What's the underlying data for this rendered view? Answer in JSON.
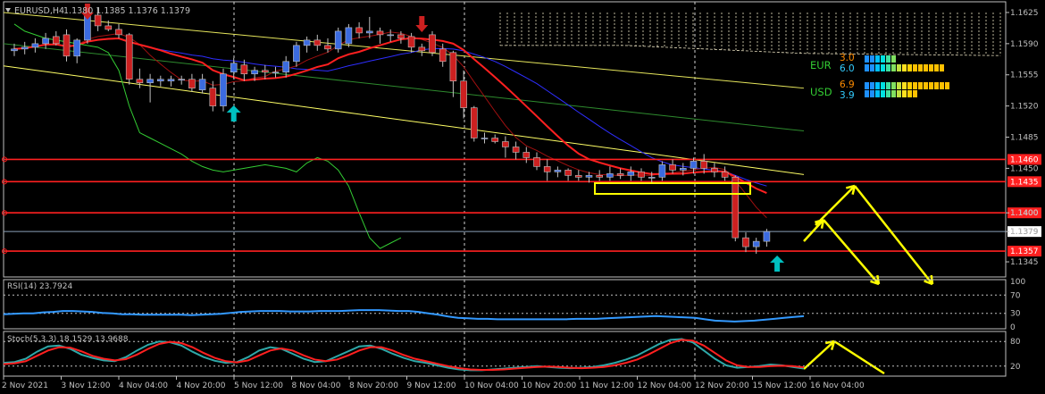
{
  "window": {
    "symbol_label": "EURUSD,H4",
    "ohlc_label": "1.1380 1.1385 1.1376 1.1379"
  },
  "panels": {
    "rsi_label": "RSI(14) 23.7924",
    "stoch_label": "Stoch(5,3,3) 18.1529 13.9688"
  },
  "strength_meter": {
    "rows": [
      {
        "currency": "EUR",
        "value_top": "3.0",
        "value_bottom": "6.0"
      },
      {
        "currency": "USD",
        "value_top": "6.9",
        "value_bottom": "3.9"
      }
    ]
  },
  "colors": {
    "background": "#000000",
    "bull": "#3b6be0",
    "bear": "#cc2020",
    "sr_line": "#ff2020",
    "ma_fast": "#ff2020",
    "ma_slow": "#2e2eff",
    "signal_arrows": "#00c0c0",
    "projection": "#ffff00",
    "rsi": "#3399ff",
    "stoch_main": "#2ea8a8",
    "stoch_signal": "#ff2020",
    "box": "#ffff00"
  },
  "chart_data": [
    {
      "type": "candlestick",
      "name": "EURUSD,H4",
      "price_axis_ticks": [
        "1.1625",
        "1.1590",
        "1.1555",
        "1.1520",
        "1.1485",
        "1.1450",
        "1.1400",
        "1.1379",
        "1.1345"
      ],
      "sr_levels": [
        {
          "price": 1.146,
          "label": "1.1460"
        },
        {
          "price": 1.1435,
          "label": "1.1435"
        },
        {
          "price": 1.14,
          "label": "1.1400"
        },
        {
          "price": 1.1357,
          "label": "1.1357"
        }
      ],
      "current_price": {
        "price": 1.1379,
        "label": "1.1379"
      },
      "time_axis_labels": [
        "2 Nov 2021",
        "3 Nov 12:00",
        "4 Nov 04:00",
        "4 Nov 20:00",
        "5 Nov 12:00",
        "8 Nov 04:00",
        "8 Nov 20:00",
        "9 Nov 12:00",
        "10 Nov 04:00",
        "10 Nov 20:00",
        "11 Nov 12:00",
        "12 Nov 04:00",
        "12 Nov 20:00",
        "15 Nov 12:00",
        "16 Nov 04:00"
      ],
      "ylim": [
        1.133,
        1.1635
      ],
      "candles": [
        [
          1.1582,
          1.159,
          1.1576,
          1.1584
        ],
        [
          1.1584,
          1.1592,
          1.1578,
          1.1586
        ],
        [
          1.1586,
          1.1596,
          1.158,
          1.159
        ],
        [
          1.159,
          1.1602,
          1.1584,
          1.1596
        ],
        [
          1.1598,
          1.1604,
          1.1588,
          1.159
        ],
        [
          1.16,
          1.1606,
          1.157,
          1.1576
        ],
        [
          1.1576,
          1.1596,
          1.1568,
          1.1594
        ],
        [
          1.1594,
          1.1628,
          1.159,
          1.1622
        ],
        [
          1.1622,
          1.163,
          1.1604,
          1.161
        ],
        [
          1.161,
          1.1616,
          1.1604,
          1.1606
        ],
        [
          1.1606,
          1.1612,
          1.1596,
          1.16
        ],
        [
          1.16,
          1.1602,
          1.1544,
          1.155
        ],
        [
          1.155,
          1.1562,
          1.154,
          1.1546
        ],
        [
          1.1546,
          1.1556,
          1.1524,
          1.155
        ],
        [
          1.1548,
          1.1554,
          1.1542,
          1.155
        ],
        [
          1.1548,
          1.1554,
          1.1542,
          1.155
        ],
        [
          1.155,
          1.1554,
          1.1544,
          1.155
        ],
        [
          1.155,
          1.1556,
          1.1536,
          1.154
        ],
        [
          1.1538,
          1.1556,
          1.1534,
          1.155
        ],
        [
          1.154,
          1.1548,
          1.1514,
          1.152
        ],
        [
          1.152,
          1.1562,
          1.1514,
          1.1556
        ],
        [
          1.1558,
          1.1574,
          1.155,
          1.1568
        ],
        [
          1.1566,
          1.1572,
          1.1548,
          1.1556
        ],
        [
          1.1556,
          1.1564,
          1.1548,
          1.156
        ],
        [
          1.156,
          1.1566,
          1.155,
          1.1558
        ],
        [
          1.1558,
          1.1564,
          1.1552,
          1.1558
        ],
        [
          1.1558,
          1.1576,
          1.1552,
          1.157
        ],
        [
          1.157,
          1.1592,
          1.1564,
          1.1588
        ],
        [
          1.1588,
          1.1598,
          1.158,
          1.1594
        ],
        [
          1.1594,
          1.16,
          1.1582,
          1.1588
        ],
        [
          1.1588,
          1.1596,
          1.158,
          1.1584
        ],
        [
          1.1584,
          1.1608,
          1.158,
          1.1604
        ],
        [
          1.159,
          1.1612,
          1.1586,
          1.1608
        ],
        [
          1.1608,
          1.1614,
          1.1596,
          1.1602
        ],
        [
          1.1602,
          1.162,
          1.1596,
          1.1604
        ],
        [
          1.1604,
          1.1608,
          1.159,
          1.16
        ],
        [
          1.16,
          1.1606,
          1.1592,
          1.16
        ],
        [
          1.16,
          1.1604,
          1.159,
          1.1596
        ],
        [
          1.1598,
          1.1602,
          1.158,
          1.1586
        ],
        [
          1.1586,
          1.159,
          1.1576,
          1.1582
        ],
        [
          1.16,
          1.1604,
          1.1576,
          1.158
        ],
        [
          1.1584,
          1.159,
          1.1564,
          1.157
        ],
        [
          1.158,
          1.1582,
          1.153,
          1.1548
        ],
        [
          1.1548,
          1.156,
          1.1506,
          1.1518
        ],
        [
          1.1518,
          1.152,
          1.148,
          1.1484
        ],
        [
          1.1484,
          1.149,
          1.1478,
          1.1484
        ],
        [
          1.1484,
          1.1488,
          1.1478,
          1.148
        ],
        [
          1.148,
          1.1486,
          1.1462,
          1.1474
        ],
        [
          1.1474,
          1.148,
          1.146,
          1.1468
        ],
        [
          1.1468,
          1.1474,
          1.1456,
          1.1462
        ],
        [
          1.1462,
          1.1468,
          1.1448,
          1.1452
        ],
        [
          1.1452,
          1.146,
          1.1436,
          1.1446
        ],
        [
          1.1446,
          1.1452,
          1.144,
          1.1448
        ],
        [
          1.1448,
          1.145,
          1.1436,
          1.1442
        ],
        [
          1.1442,
          1.1448,
          1.1436,
          1.144
        ],
        [
          1.144,
          1.1446,
          1.1434,
          1.1442
        ],
        [
          1.1442,
          1.1448,
          1.1436,
          1.144
        ],
        [
          1.144,
          1.1452,
          1.1436,
          1.1444
        ],
        [
          1.1444,
          1.145,
          1.1438,
          1.1442
        ],
        [
          1.1442,
          1.1452,
          1.1436,
          1.1446
        ],
        [
          1.1446,
          1.145,
          1.1436,
          1.144
        ],
        [
          1.144,
          1.1446,
          1.1434,
          1.144
        ],
        [
          1.144,
          1.1458,
          1.1436,
          1.1454
        ],
        [
          1.1454,
          1.146,
          1.1444,
          1.1448
        ],
        [
          1.1448,
          1.1456,
          1.1442,
          1.145
        ],
        [
          1.145,
          1.1462,
          1.1444,
          1.1458
        ],
        [
          1.1458,
          1.1466,
          1.1444,
          1.145
        ],
        [
          1.145,
          1.1456,
          1.144,
          1.1446
        ],
        [
          1.1446,
          1.1452,
          1.1436,
          1.144
        ],
        [
          1.144,
          1.1442,
          1.1368,
          1.1372
        ],
        [
          1.1372,
          1.1378,
          1.1356,
          1.1362
        ],
        [
          1.1362,
          1.1372,
          1.1354,
          1.1368
        ],
        [
          1.1368,
          1.1382,
          1.1362,
          1.1379
        ]
      ]
    },
    {
      "type": "line",
      "name": "RSI(14)",
      "ylim": [
        0,
        100
      ],
      "y_ticks": [
        "100",
        "70",
        "30",
        "0"
      ],
      "levels": [
        70,
        30
      ],
      "values": [
        28,
        29,
        30,
        30,
        32,
        33,
        35,
        35,
        34,
        33,
        31,
        30,
        28,
        28,
        27,
        27,
        27,
        27,
        27,
        26,
        27,
        28,
        29,
        31,
        33,
        34,
        35,
        35,
        35,
        34,
        34,
        34,
        35,
        35,
        35,
        36,
        37,
        37,
        37,
        36,
        35,
        35,
        33,
        30,
        27,
        23,
        20,
        19,
        18,
        18,
        17,
        17,
        17,
        17,
        17,
        17,
        17,
        17,
        18,
        18,
        18,
        19,
        20,
        21,
        22,
        23,
        24,
        23,
        22,
        21,
        20,
        17,
        14,
        13,
        12,
        13,
        14,
        16,
        18,
        20,
        22,
        23.8
      ]
    },
    {
      "type": "line",
      "name": "Stoch(5,3,3)",
      "ylim": [
        0,
        100
      ],
      "y_ticks": [
        "80",
        "20"
      ],
      "levels": [
        80,
        20
      ],
      "series": [
        {
          "name": "main",
          "values": [
            28,
            30,
            38,
            55,
            68,
            70,
            62,
            48,
            40,
            34,
            32,
            42,
            58,
            72,
            80,
            78,
            70,
            55,
            42,
            33,
            28,
            30,
            42,
            58,
            66,
            62,
            50,
            38,
            30,
            32,
            44,
            56,
            68,
            70,
            62,
            50,
            40,
            32,
            28,
            22,
            16,
            12,
            10,
            10,
            12,
            14,
            16,
            18,
            20,
            18,
            16,
            15,
            16,
            18,
            22,
            28,
            36,
            46,
            60,
            74,
            84,
            86,
            78,
            58,
            38,
            22,
            16,
            18,
            20,
            24,
            22,
            18,
            14
          ]
        },
        {
          "name": "signal",
          "values": [
            25,
            27,
            32,
            45,
            58,
            66,
            65,
            56,
            45,
            38,
            34,
            37,
            48,
            62,
            74,
            79,
            76,
            66,
            52,
            40,
            32,
            29,
            34,
            46,
            58,
            63,
            58,
            46,
            36,
            32,
            36,
            46,
            58,
            66,
            66,
            58,
            47,
            38,
            32,
            26,
            20,
            15,
            12,
            11,
            11,
            12,
            14,
            16,
            18,
            19,
            18,
            16,
            15,
            16,
            18,
            22,
            28,
            36,
            48,
            62,
            76,
            84,
            82,
            70,
            52,
            34,
            22,
            18,
            18,
            20,
            21,
            20,
            17
          ]
        }
      ]
    }
  ]
}
